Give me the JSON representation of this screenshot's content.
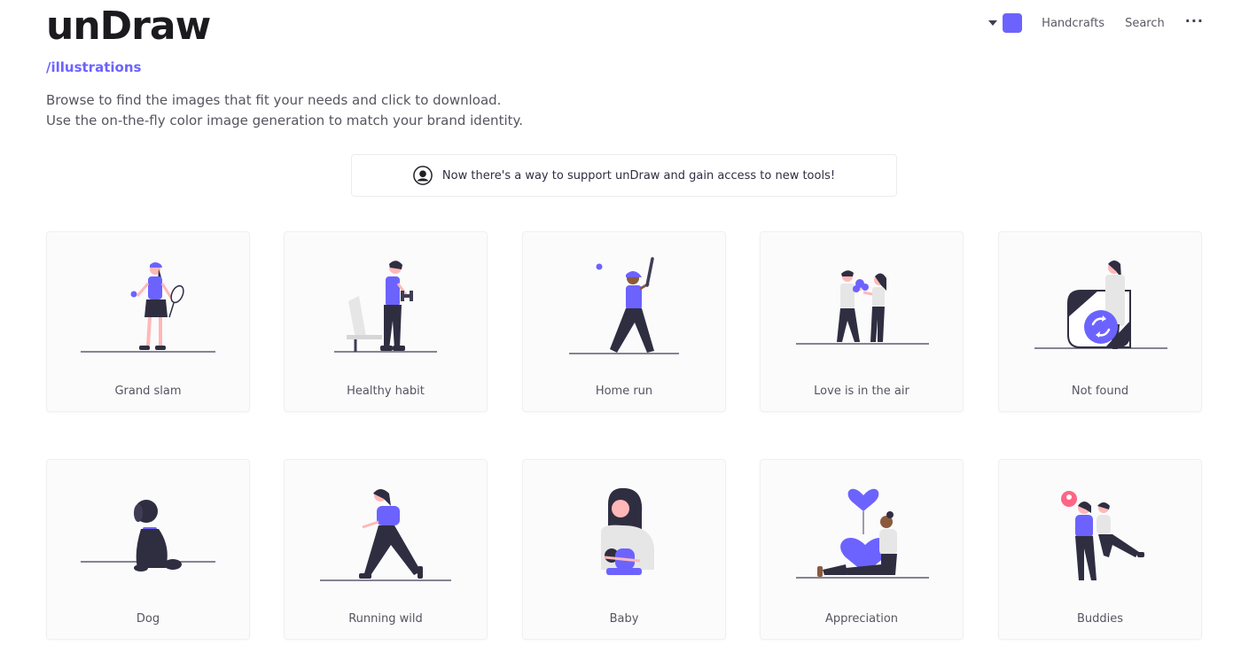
{
  "header": {
    "logo": "unDraw",
    "section_link": "/illustrations",
    "intro": "Browse to find the images that fit your needs and click to download. Use the on-the-fly color image generation to match your brand identity."
  },
  "nav": {
    "accent_color": "#6c63ff",
    "handcrafts": "Handcrafts",
    "search": "Search",
    "more": "···"
  },
  "banner": {
    "text": "Now there's a way to support unDraw and gain access to new tools!",
    "icon": "user-avatar-icon"
  },
  "illustrations": [
    {
      "title": "Grand slam"
    },
    {
      "title": "Healthy habit"
    },
    {
      "title": "Home run"
    },
    {
      "title": "Love is in the air"
    },
    {
      "title": "Not found"
    },
    {
      "title": "Dog"
    },
    {
      "title": "Running wild"
    },
    {
      "title": "Baby"
    },
    {
      "title": "Appreciation"
    },
    {
      "title": "Buddies"
    }
  ]
}
